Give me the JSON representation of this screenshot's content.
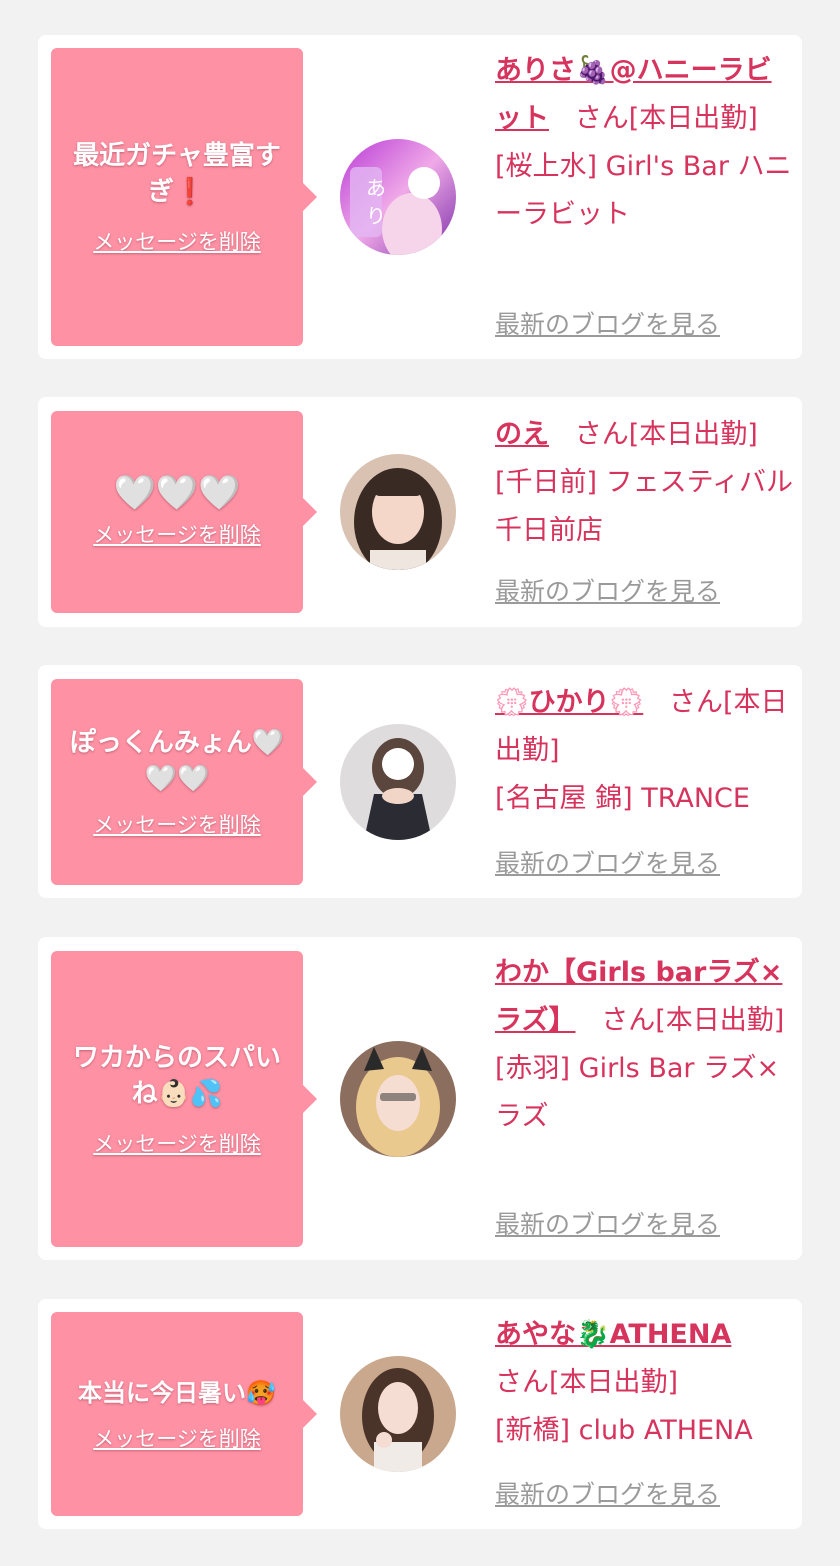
{
  "delete_label": "メッセージを削除",
  "blog_label": "最新のブログを見る",
  "cards": [
    {
      "message": "最近ガチャ豊富すぎ❗",
      "name": "ありさ🍇@ハニーラビット",
      "honorific": "さん[本日出勤]",
      "shop": "[桜上水] Girl's Bar ハニーラビット"
    },
    {
      "message": "🤍🤍🤍",
      "name": "のえ",
      "honorific": "さん[本日出勤]",
      "shop": "[千日前] フェスティバル 千日前店"
    },
    {
      "message": "ぽっくんみょん🤍🤍🤍",
      "name": "💮ひかり💮",
      "honorific": "さん[本日出勤]",
      "shop": "[名古屋 錦] TRANCE"
    },
    {
      "message": "ワカからのスパいね👶🏻💦",
      "name": "わか【Girls barラズ×ラズ】",
      "honorific": "さん[本日出勤]",
      "shop": "[赤羽] Girls Bar ラズ×ラズ"
    },
    {
      "message": "本当に今日暑い🥵",
      "name": "あやな🐉ATHENA",
      "honorific": "さん[本日出勤]",
      "shop": "[新橋] club ATHENA"
    }
  ],
  "colors": {
    "background": "#f2f2f2",
    "card": "#ffffff",
    "bubble": "#ff91a4",
    "accent_text": "#d6335d",
    "link_gray": "#9a9a9a"
  }
}
